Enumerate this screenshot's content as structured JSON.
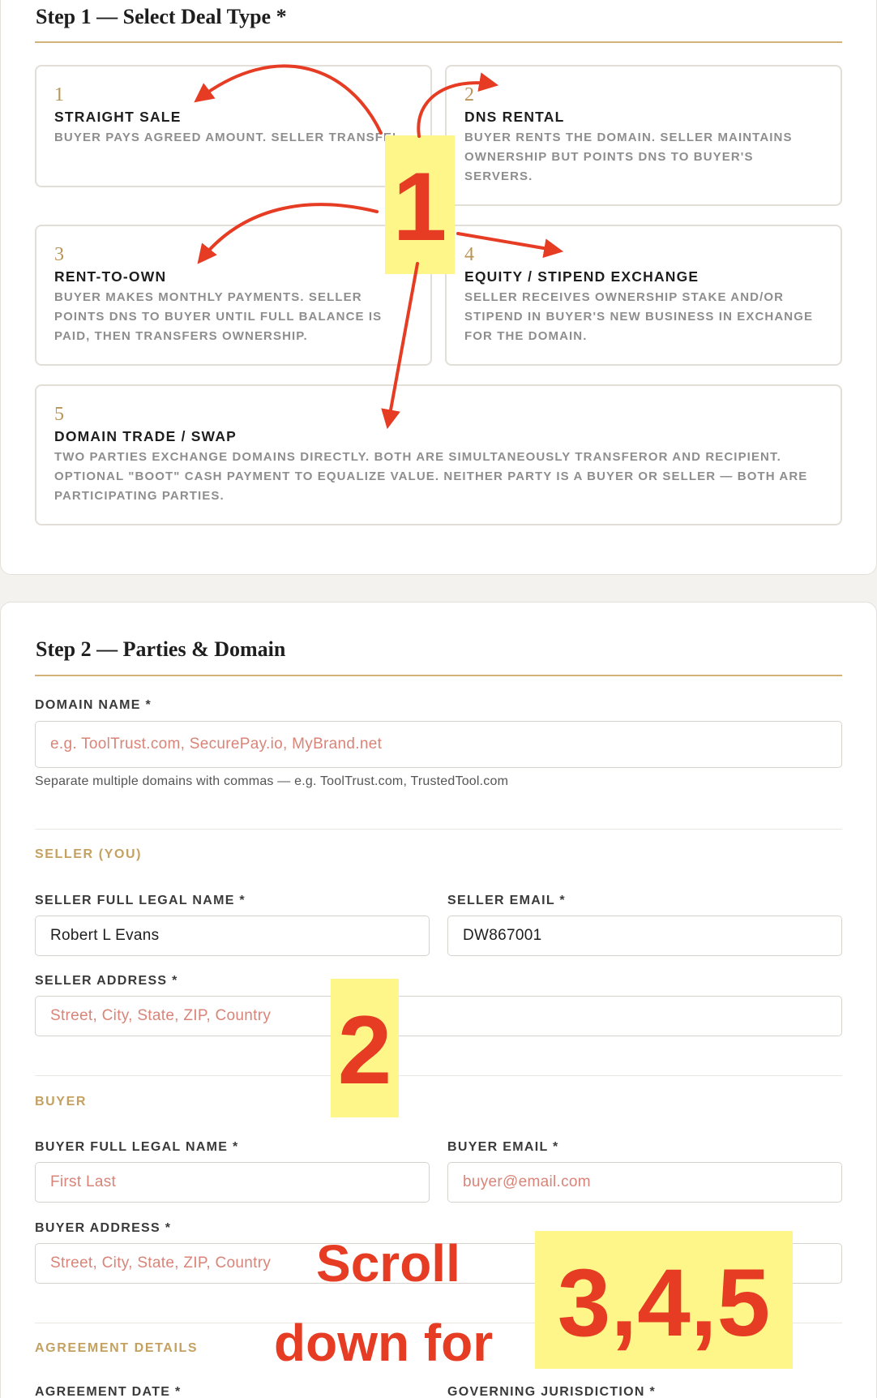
{
  "step1": {
    "title": "Step 1 — Select Deal Type *",
    "options": [
      {
        "num": "1",
        "title": "STRAIGHT SALE",
        "desc": "BUYER PAYS AGREED AMOUNT. SELLER TRANSFERS DOMAIN OWNERSHIP AT REGISTRA"
      },
      {
        "num": "2",
        "title": "DNS RENTAL",
        "desc": "BUYER RENTS THE DOMAIN. SELLER MAINTAINS OWNERSHIP BUT POINTS DNS TO BUYER'S SERVERS."
      },
      {
        "num": "3",
        "title": "RENT-TO-OWN",
        "desc": "BUYER MAKES MONTHLY PAYMENTS. SELLER POINTS DNS TO BUYER UNTIL FULL BALANCE IS PAID, THEN TRANSFERS OWNERSHIP."
      },
      {
        "num": "4",
        "title": "EQUITY / STIPEND EXCHANGE",
        "desc": "SELLER RECEIVES OWNERSHIP STAKE AND/OR STIPEND IN BUYER'S NEW BUSINESS IN EXCHANGE FOR THE DOMAIN."
      },
      {
        "num": "5",
        "title": "DOMAIN TRADE / SWAP",
        "desc": "TWO PARTIES EXCHANGE DOMAINS DIRECTLY. BOTH ARE SIMULTANEOUSLY TRANSFEROR AND RECIPIENT. OPTIONAL \"BOOT\" CASH PAYMENT TO EQUALIZE VALUE. NEITHER PARTY IS A BUYER OR SELLER — BOTH ARE PARTICIPATING PARTIES."
      }
    ]
  },
  "step2": {
    "title": "Step 2 — Parties & Domain",
    "domain": {
      "label": "DOMAIN NAME *",
      "placeholder": "e.g. ToolTrust.com, SecurePay.io, MyBrand.net",
      "hint": "Separate multiple domains with commas — e.g. ToolTrust.com, TrustedTool.com"
    },
    "seller": {
      "section": "SELLER (YOU)",
      "name_label": "SELLER FULL LEGAL NAME *",
      "name_value": "Robert L Evans",
      "email_label": "SELLER EMAIL *",
      "email_value": "DW867001",
      "address_label": "SELLER ADDRESS *",
      "address_placeholder": "Street, City, State, ZIP, Country"
    },
    "buyer": {
      "section": "BUYER",
      "name_label": "BUYER FULL LEGAL NAME *",
      "name_placeholder": "First Last",
      "email_label": "BUYER EMAIL *",
      "email_placeholder": "buyer@email.com",
      "address_label": "BUYER ADDRESS *",
      "address_placeholder": "Street, City, State, ZIP, Country"
    },
    "agreement": {
      "section": "AGREEMENT DETAILS",
      "date_label": "AGREEMENT DATE *",
      "jurisdiction_label": "GOVERNING JURISDICTION *"
    }
  },
  "annotations": {
    "marker1": "1",
    "marker2": "2",
    "scroll_line1": "Scroll",
    "scroll_line2": "down for",
    "marker345": "3,4,5",
    "color": "#e63c24",
    "highlight": "#fff689"
  }
}
